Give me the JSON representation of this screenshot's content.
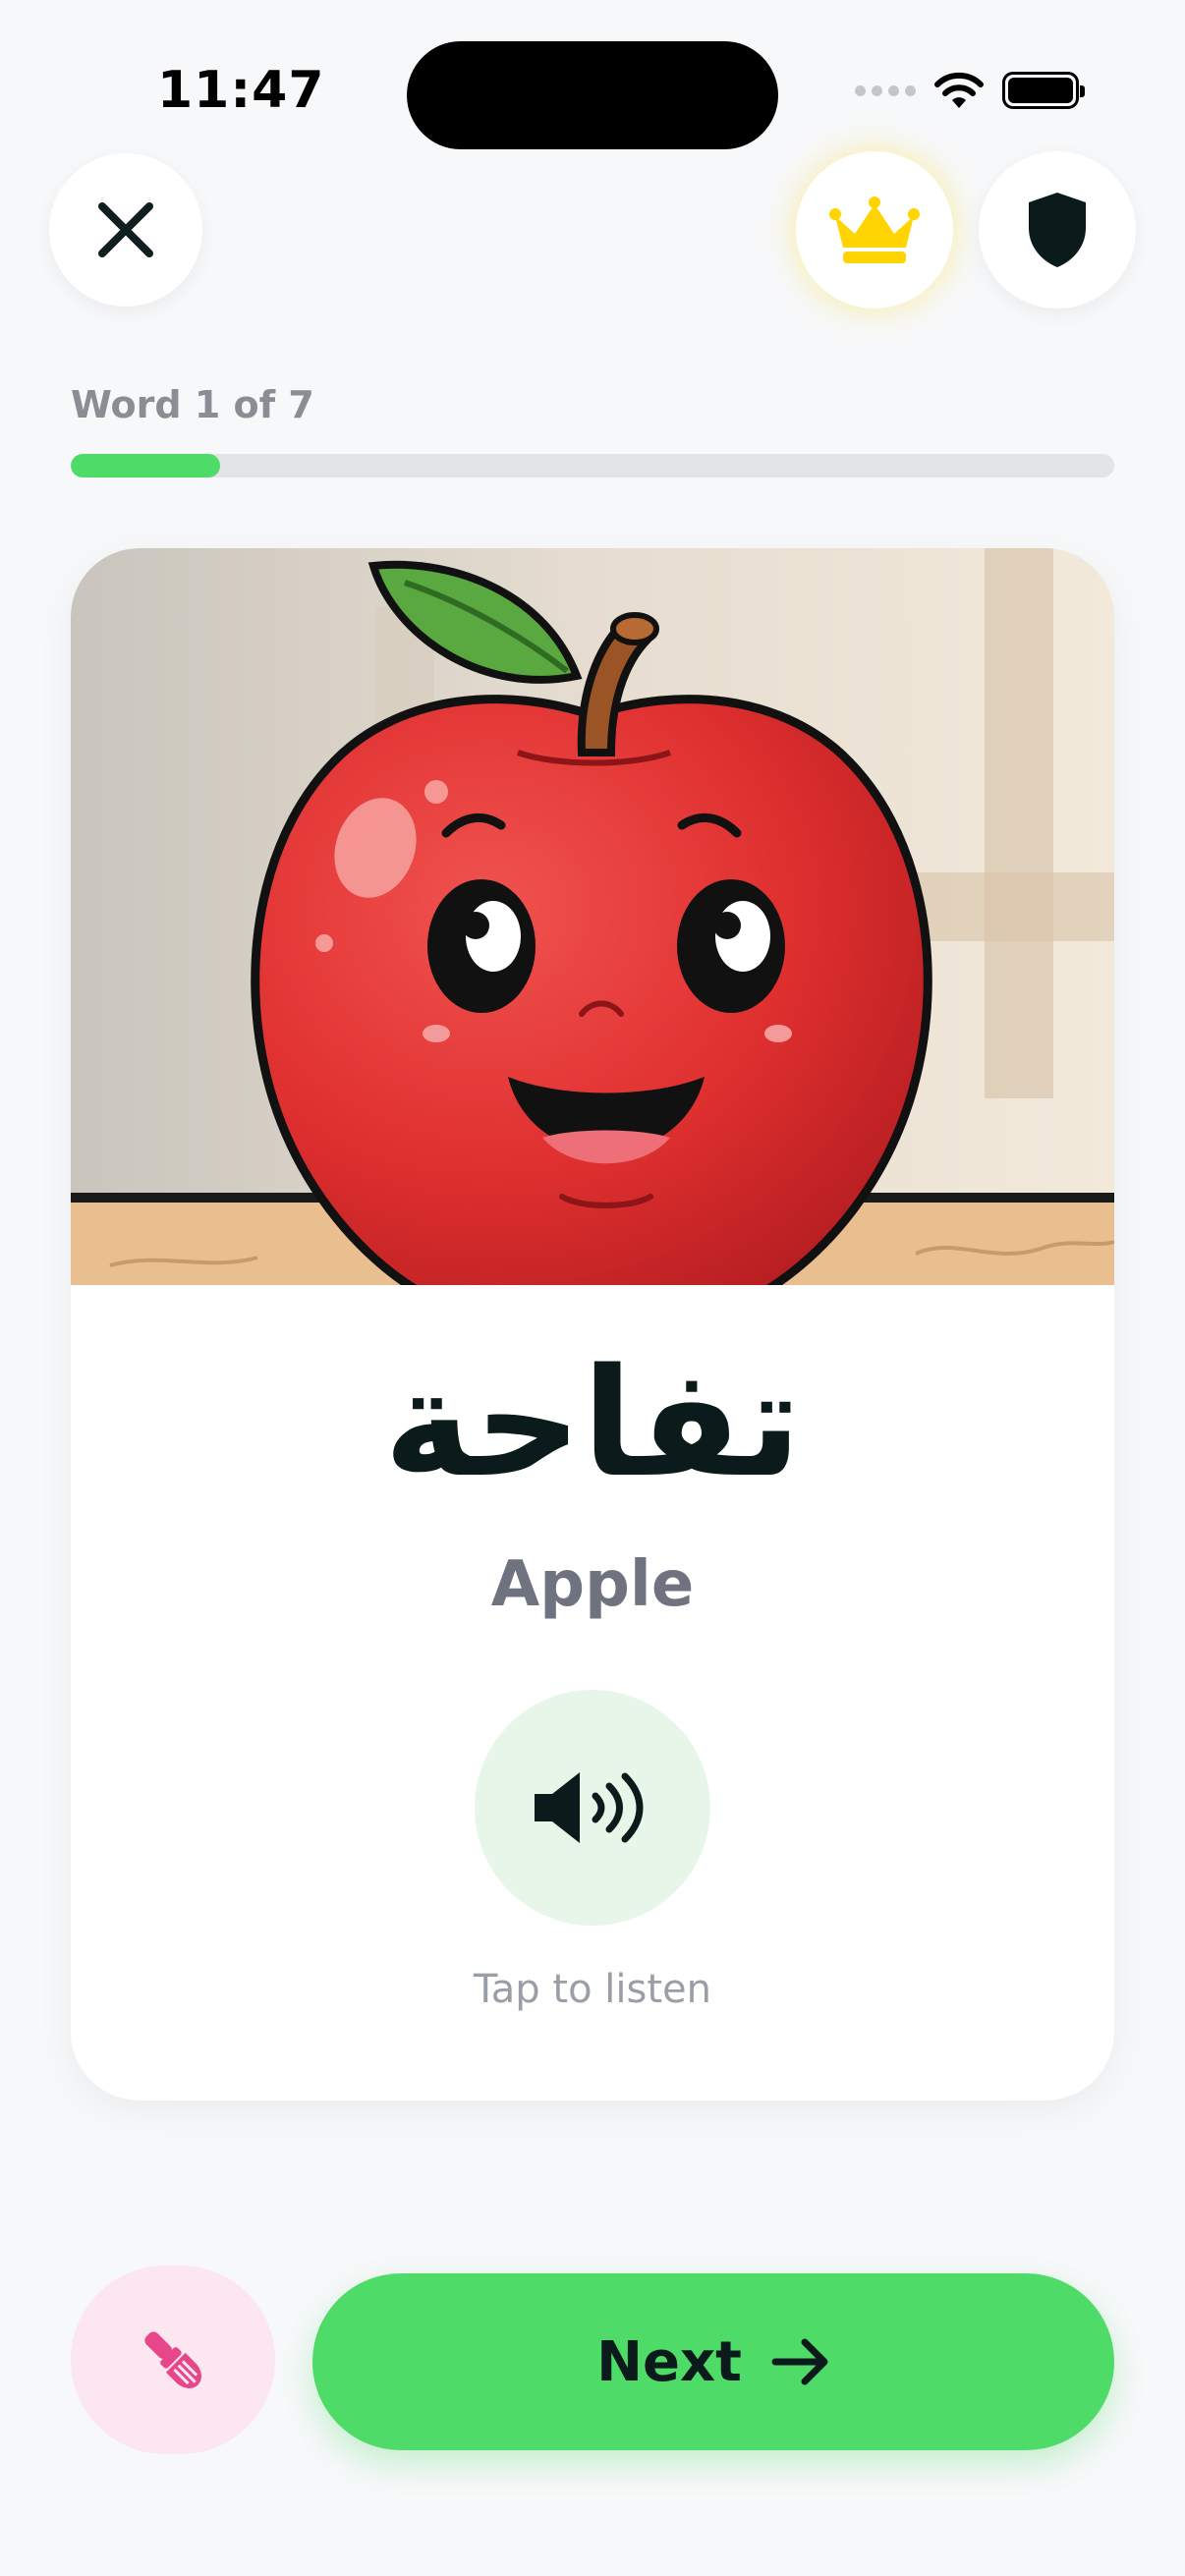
{
  "status_bar": {
    "time": "11:47"
  },
  "header": {
    "close_icon": "close-icon",
    "crown_icon": "crown-icon",
    "shield_icon": "shield-icon"
  },
  "progress": {
    "label": "Word 1 of 7",
    "current": 1,
    "total": 7
  },
  "card": {
    "image": "cartoon-apple",
    "arabic_word": "تفاحة",
    "english_word": "Apple",
    "audio_icon": "speaker-icon",
    "tap_hint": "Tap to listen"
  },
  "footer": {
    "brush_icon": "paintbrush-icon",
    "next_label": "Next",
    "next_icon": "arrow-right-icon"
  },
  "colors": {
    "accent_green": "#4fdb68",
    "crown_yellow": "#ffd400",
    "brush_pink": "#e8468b",
    "background": "#f7f8fa"
  }
}
